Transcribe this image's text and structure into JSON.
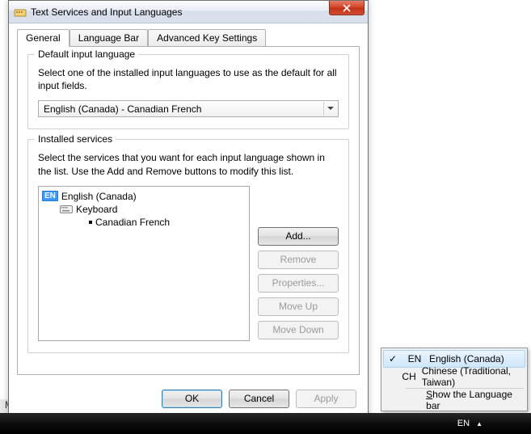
{
  "dialog": {
    "title": "Text Services and Input Languages",
    "tabs": [
      "General",
      "Language Bar",
      "Advanced Key Settings"
    ],
    "defaultLang": {
      "legend": "Default input language",
      "desc": "Select one of the installed input languages to use as the default for all input fields.",
      "selected": "English (Canada) - Canadian French"
    },
    "installed": {
      "legend": "Installed services",
      "desc": "Select the services that you want for each input language shown in the list. Use the Add and Remove buttons to modify this list.",
      "tree": {
        "langBadge": "EN",
        "lang": "English (Canada)",
        "category": "Keyboard",
        "layout": "Canadian French"
      },
      "buttons": {
        "add": "Add...",
        "remove": "Remove",
        "properties": "Properties...",
        "moveUp": "Move Up",
        "moveDown": "Move Down"
      }
    },
    "buttons": {
      "ok": "OK",
      "cancel": "Cancel",
      "apply": "Apply"
    }
  },
  "bgText": "Microsoft Corp.",
  "menu": {
    "items": [
      {
        "check": "✓",
        "code": "EN",
        "label": "English (Canada)",
        "selected": true
      },
      {
        "check": "",
        "code": "CH",
        "label": "Chinese (Traditional, Taiwan)",
        "selected": false
      }
    ],
    "showBarPrefix": "S",
    "showBarRest": "how the Language bar"
  },
  "taskbar": {
    "lang": "EN"
  }
}
